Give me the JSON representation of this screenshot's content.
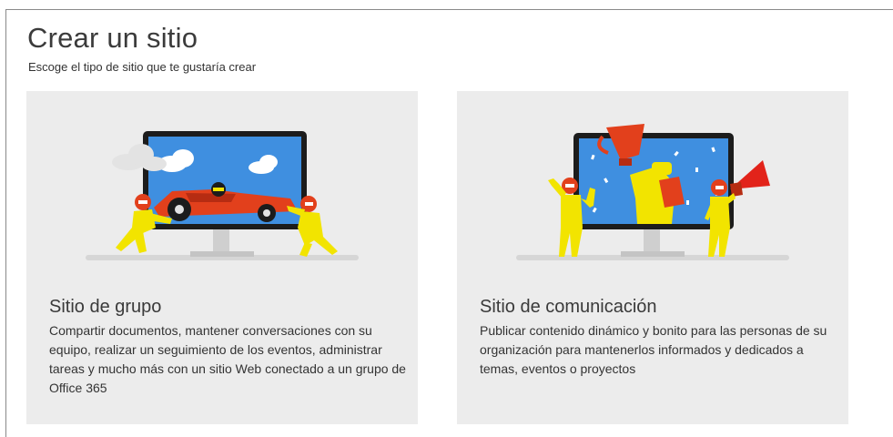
{
  "header": {
    "title": "Crear un sitio",
    "subtitle": "Escoge el tipo de sitio que te gustaría crear"
  },
  "cards": [
    {
      "title": "Sitio de grupo",
      "description": "Compartir documentos, mantener conversaciones con su equipo, realizar un seguimiento de los eventos, administrar tareas y mucho más con un sitio Web conectado a un grupo de Office 365",
      "illustration": "race-car-monitor-illustration"
    },
    {
      "title": "Sitio de comunicación",
      "description": "Publicar contenido dinámico y bonito para las personas de su organización para mantenerlos informados y dedicados a temas, eventos o proyectos",
      "illustration": "trophy-megaphone-monitor-illustration"
    }
  ],
  "colors": {
    "card_bg": "#ececec",
    "screen_blue": "#3f8fe0",
    "monitor_frame": "#1c1c1c",
    "figure_yellow": "#f2e400",
    "accent_red": "#e2231a"
  }
}
